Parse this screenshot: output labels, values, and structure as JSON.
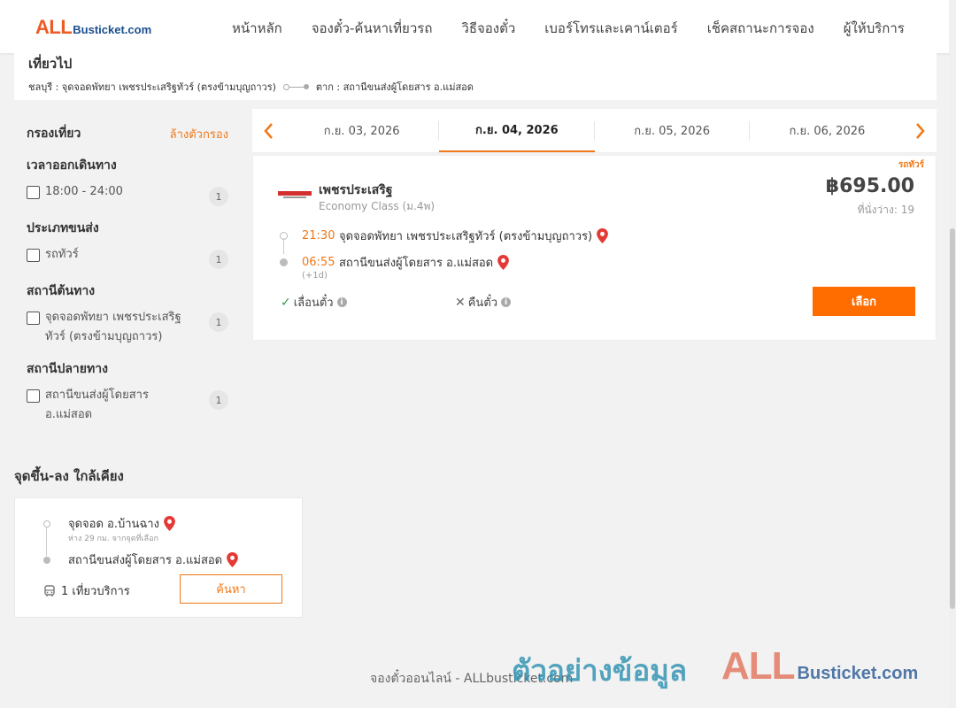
{
  "logo": {
    "all": "ALL",
    "rest": "Busticket.com"
  },
  "nav": [
    "หน้าหลัก",
    "จองตั๋ว-ค้นหาเที่ยวรถ",
    "วิธีจองตั๋ว",
    "เบอร์โทรและเคาน์เตอร์",
    "เช็คสถานะการจอง",
    "ผู้ให้บริการ"
  ],
  "trip": {
    "title": "เที่ยวไป",
    "origin": "ชลบุรี : จุดจอดพัทยา เพชรประเสริฐทัวร์ (ตรงข้ามบุญถาวร)",
    "destination": "ตาก : สถานีขนส่งผู้โดยสาร อ.แม่สอด"
  },
  "filters": {
    "title": "กรองเที่ยว",
    "clear": "ล้างตัวกรอง",
    "groups": [
      {
        "title": "เวลาออกเดินทาง",
        "options": [
          {
            "label": "18:00 - 24:00",
            "count": "1"
          }
        ]
      },
      {
        "title": "ประเภทขนส่ง",
        "options": [
          {
            "label": "รถทัวร์",
            "count": "1"
          }
        ]
      },
      {
        "title": "สถานีต้นทาง",
        "options": [
          {
            "label": "จุดจอดพัทยา เพชรประเสริฐทัวร์ (ตรงข้ามบุญถาวร)",
            "count": "1"
          }
        ]
      },
      {
        "title": "สถานีปลายทาง",
        "options": [
          {
            "label": "สถานีขนส่งผู้โดยสาร อ.แม่สอด",
            "count": "1"
          }
        ]
      }
    ]
  },
  "dates": {
    "prev": "‹",
    "next": "›",
    "tabs": [
      "ก.ย. 03, 2026",
      "ก.ย. 04, 2026",
      "ก.ย. 05, 2026",
      "ก.ย. 06, 2026"
    ],
    "active_index": 1
  },
  "result": {
    "type_tag": "รถทัวร์",
    "operator": "เพชรประเสริฐ",
    "class": "Economy Class (ม.4พ)",
    "price": "฿695.00",
    "seats": "ที่นั่งว่าง: 19",
    "depart_time": "21:30",
    "depart_place": "จุดจอดพัทยา เพชรประเสริฐทัวร์ (ตรงข้ามบุญถาวร)",
    "arrive_time": "06:55",
    "arrive_day": "(+1d)",
    "arrive_place": "สถานีขนส่งผู้โดยสาร อ.แม่สอด",
    "reschedule": "เลื่อนตั๋ว",
    "refund": "คืนตั๋ว",
    "select": "เลือก"
  },
  "nearby": {
    "title": "จุดขึ้น-ลง ใกล้เคียง",
    "origin": "จุดจอด อ.บ้านฉาง",
    "distance": "ห่าง 29 กม. จากจุดที่เลือก",
    "destination": "สถานีขนส่งผู้โดยสาร อ.แม่สอด",
    "trips": "1 เที่ยวบริการ",
    "search": "ค้นหา"
  },
  "footer": "จองตั๋วออนไลน์ - ALLbusticket.com",
  "watermark": {
    "thai": "ตัวอย่างข้อมูล",
    "all": "ALL",
    "rest": "Busticket.com"
  },
  "colors": {
    "accent": "#f07818",
    "button": "#ff6d00",
    "brand_blue": "#1b4f8f",
    "pin": "#e53935"
  }
}
